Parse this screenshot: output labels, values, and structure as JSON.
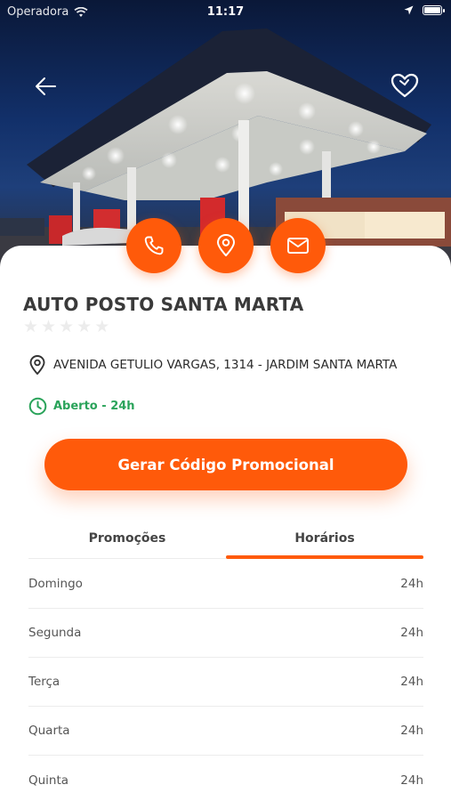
{
  "status_bar": {
    "carrier": "Operadora",
    "time": "11:17"
  },
  "hero": {
    "image": "gas-station-photo"
  },
  "actions": [
    {
      "icon": "phone-icon"
    },
    {
      "icon": "location-pin-icon"
    },
    {
      "icon": "mail-icon"
    }
  ],
  "station": {
    "name": "AUTO POSTO SANTA MARTA",
    "rating": 0,
    "rating_max": 5,
    "address": "AVENIDA GETULIO VARGAS, 1314 - JARDIM SANTA MARTA",
    "open_status": "Aberto - 24h"
  },
  "cta_label": "Gerar Código Promocional",
  "tabs": [
    {
      "label": "Promoções",
      "active": false
    },
    {
      "label": "Horários",
      "active": true
    }
  ],
  "schedule": [
    {
      "day": "Domingo",
      "hours": "24h"
    },
    {
      "day": "Segunda",
      "hours": "24h"
    },
    {
      "day": "Terça",
      "hours": "24h"
    },
    {
      "day": "Quarta",
      "hours": "24h"
    },
    {
      "day": "Quinta",
      "hours": "24h"
    }
  ],
  "colors": {
    "accent": "#ff5a0a",
    "open_green": "#2aa35a",
    "title": "#3a3a3a"
  }
}
